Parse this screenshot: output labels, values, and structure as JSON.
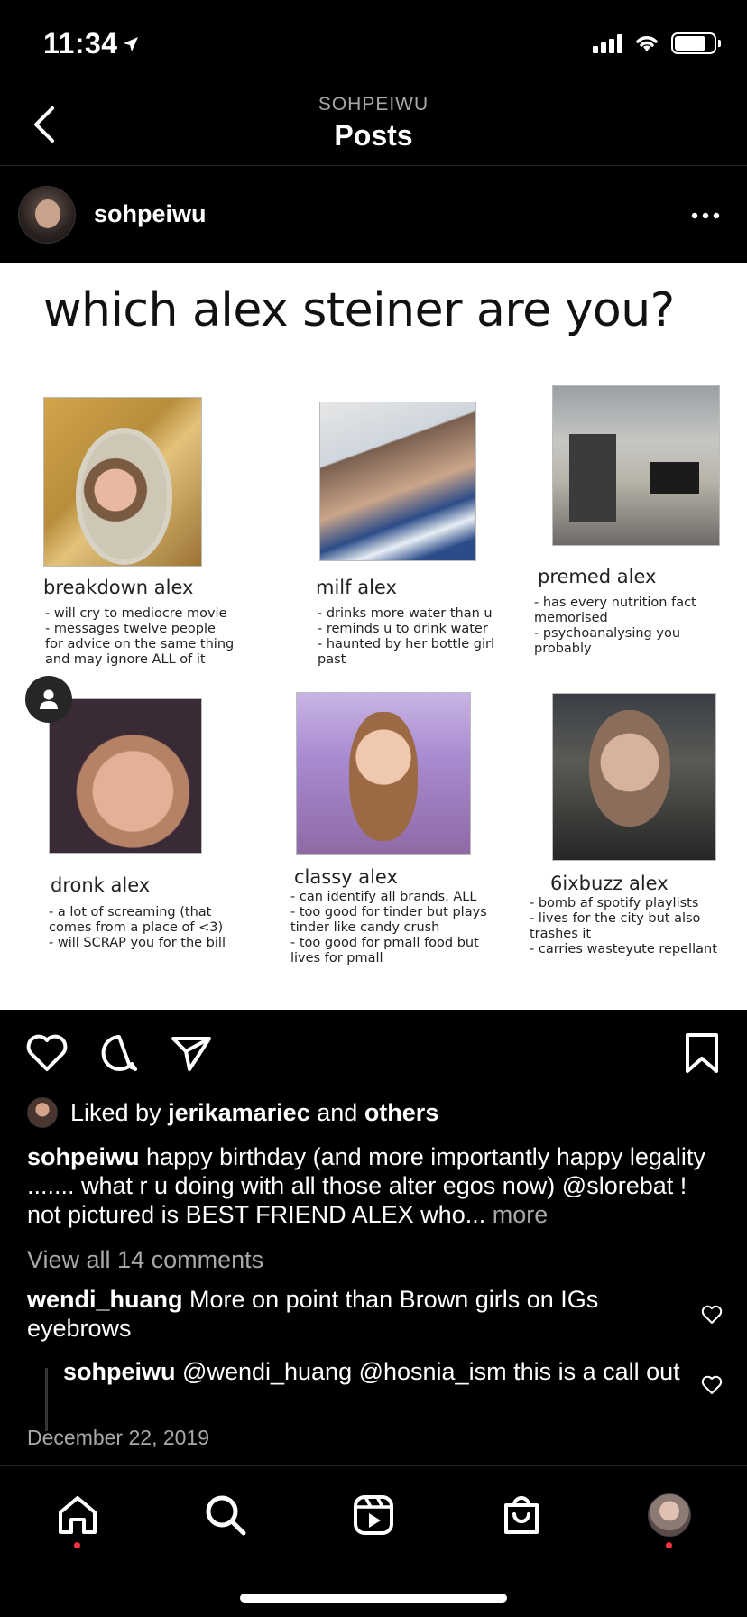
{
  "status_bar": {
    "time": "11:34",
    "location_arrow": "location-arrow-icon"
  },
  "header": {
    "subtitle": "SOHPEIWU",
    "title": "Posts"
  },
  "post": {
    "username": "sohpeiwu",
    "image": {
      "title": "which alex steiner are you?",
      "cards": [
        {
          "name": "breakdown alex",
          "desc": [
            "- will cry to mediocre movie",
            "- messages twelve people",
            "for advice on the same thing",
            "and may ignore ALL of it"
          ]
        },
        {
          "name": "milf alex",
          "desc": [
            "- drinks more water than u",
            "- reminds u to drink water",
            "- haunted by her bottle girl",
            "past"
          ]
        },
        {
          "name": "premed alex",
          "desc": [
            "- has every nutrition fact",
            "memorised",
            "- psychoanalysing you",
            "probably"
          ]
        },
        {
          "name": "dronk alex",
          "desc": [
            "- a lot of screaming (that",
            "comes from a place of <3)",
            "- will SCRAP you for the bill"
          ]
        },
        {
          "name": "classy alex",
          "desc": [
            "- can identify all brands. ALL",
            "- too good for tinder but plays",
            "tinder like candy crush",
            "- too good for pmall food but",
            "lives for pmall"
          ]
        },
        {
          "name": "6ixbuzz alex",
          "desc": [
            "- bomb af spotify playlists",
            "- lives for the city but also",
            "trashes it",
            "- carries wasteyute repellant"
          ]
        }
      ]
    },
    "likes": {
      "prefix": "Liked by",
      "user": "jerikamariec",
      "and": "and",
      "others": "others"
    },
    "caption": {
      "user": "sohpeiwu",
      "text": "happy birthday (and more importantly happy legality ....... what r u doing with all those alter egos now) @slorebat ! not pictured is BEST FRIEND ALEX who...",
      "more": "more"
    },
    "view_comments": "View all 14 comments",
    "comments": [
      {
        "user": "wendi_huang",
        "text": "More on point than Brown girls on IGs eyebrows"
      },
      {
        "user": "sohpeiwu",
        "text": "@wendi_huang @hosnia_ism this is a call out"
      }
    ],
    "date": "December 22, 2019"
  },
  "icons": {
    "back": "chevron-left-icon",
    "more": "more-horizontal-icon",
    "like": "heart-icon",
    "comment": "comment-icon",
    "share": "send-icon",
    "save": "bookmark-icon",
    "home": "home-icon",
    "search": "search-icon",
    "reels": "reels-icon",
    "shop": "shop-icon",
    "profile": "profile-avatar"
  },
  "colors": {
    "background": "#000000",
    "muted": "#a8a8a8",
    "notification_dot": "#ff3040"
  }
}
